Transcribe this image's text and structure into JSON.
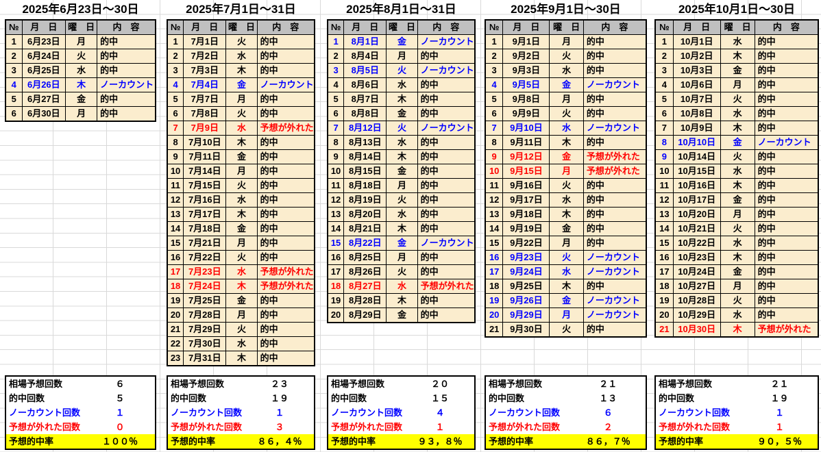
{
  "colors": {
    "hit_text": "#000000",
    "nocount_text": "#0000FF",
    "miss_text": "#FF0000",
    "cell_background": "#FBEDCE",
    "header_background": "#C0C0C0",
    "rate_row_background": "#FFFF00",
    "gridline": "#D9D9D9"
  },
  "column_headers": [
    "№",
    "月　日",
    "曜　日",
    "内　容"
  ],
  "tables": [
    {
      "title": "2025年6月23日～30日",
      "rows": [
        {
          "no": "1",
          "date": "6月23日",
          "day": "月",
          "content": "的中",
          "cls": "hit"
        },
        {
          "no": "2",
          "date": "6月24日",
          "day": "火",
          "content": "的中",
          "cls": "hit"
        },
        {
          "no": "3",
          "date": "6月25日",
          "day": "水",
          "content": "的中",
          "cls": "hit"
        },
        {
          "no": "4",
          "date": "6月26日",
          "day": "木",
          "content": "ノーカウント",
          "cls": "nocount"
        },
        {
          "no": "5",
          "date": "6月27日",
          "day": "金",
          "content": "的中",
          "cls": "hit"
        },
        {
          "no": "6",
          "date": "6月30日",
          "day": "月",
          "content": "的中",
          "cls": "hit"
        }
      ],
      "summary": [
        {
          "label": "相場予想回数",
          "value": "６",
          "cls": "normal"
        },
        {
          "label": "的中回数",
          "value": "５",
          "cls": "normal"
        },
        {
          "label": "ノーカウント回数",
          "value": "１",
          "cls": "nocount"
        },
        {
          "label": "予想が外れた回数",
          "value": "０",
          "cls": "miss"
        },
        {
          "label": "予想的中率",
          "value": "１００％",
          "cls": "rate"
        }
      ]
    },
    {
      "title": "2025年7月1日～31日",
      "rows": [
        {
          "no": "1",
          "date": "7月1日",
          "day": "火",
          "content": "的中",
          "cls": "hit"
        },
        {
          "no": "2",
          "date": "7月2日",
          "day": "水",
          "content": "的中",
          "cls": "hit"
        },
        {
          "no": "3",
          "date": "7月3日",
          "day": "木",
          "content": "的中",
          "cls": "hit"
        },
        {
          "no": "4",
          "date": "7月4日",
          "day": "金",
          "content": "ノーカウント",
          "cls": "nocount"
        },
        {
          "no": "5",
          "date": "7月7日",
          "day": "月",
          "content": "的中",
          "cls": "hit"
        },
        {
          "no": "6",
          "date": "7月8日",
          "day": "火",
          "content": "的中",
          "cls": "hit"
        },
        {
          "no": "7",
          "date": "7月9日",
          "day": "水",
          "content": "予想が外れた",
          "cls": "miss"
        },
        {
          "no": "8",
          "date": "7月10日",
          "day": "木",
          "content": "的中",
          "cls": "hit"
        },
        {
          "no": "9",
          "date": "7月11日",
          "day": "金",
          "content": "的中",
          "cls": "hit"
        },
        {
          "no": "10",
          "date": "7月14日",
          "day": "月",
          "content": "的中",
          "cls": "hit"
        },
        {
          "no": "11",
          "date": "7月15日",
          "day": "火",
          "content": "的中",
          "cls": "hit"
        },
        {
          "no": "12",
          "date": "7月16日",
          "day": "水",
          "content": "的中",
          "cls": "hit"
        },
        {
          "no": "13",
          "date": "7月17日",
          "day": "木",
          "content": "的中",
          "cls": "hit"
        },
        {
          "no": "14",
          "date": "7月18日",
          "day": "金",
          "content": "的中",
          "cls": "hit"
        },
        {
          "no": "15",
          "date": "7月21日",
          "day": "月",
          "content": "的中",
          "cls": "hit"
        },
        {
          "no": "16",
          "date": "7月22日",
          "day": "火",
          "content": "的中",
          "cls": "hit"
        },
        {
          "no": "17",
          "date": "7月23日",
          "day": "水",
          "content": "予想が外れた",
          "cls": "miss"
        },
        {
          "no": "18",
          "date": "7月24日",
          "day": "木",
          "content": "予想が外れた",
          "cls": "miss"
        },
        {
          "no": "19",
          "date": "7月25日",
          "day": "金",
          "content": "的中",
          "cls": "hit"
        },
        {
          "no": "20",
          "date": "7月28日",
          "day": "月",
          "content": "的中",
          "cls": "hit"
        },
        {
          "no": "21",
          "date": "7月29日",
          "day": "火",
          "content": "的中",
          "cls": "hit"
        },
        {
          "no": "22",
          "date": "7月30日",
          "day": "水",
          "content": "的中",
          "cls": "hit"
        },
        {
          "no": "23",
          "date": "7月31日",
          "day": "木",
          "content": "的中",
          "cls": "hit"
        }
      ],
      "summary": [
        {
          "label": "相場予想回数",
          "value": "２３",
          "cls": "normal"
        },
        {
          "label": "的中回数",
          "value": "１９",
          "cls": "normal"
        },
        {
          "label": "ノーカウント回数",
          "value": "１",
          "cls": "nocount"
        },
        {
          "label": "予想が外れた回数",
          "value": "３",
          "cls": "miss"
        },
        {
          "label": "予想的中率",
          "value": "８６，４％",
          "cls": "rate"
        }
      ]
    },
    {
      "title": "2025年8月1日～31日",
      "rows": [
        {
          "no": "1",
          "date": "8月1日",
          "day": "金",
          "content": "ノーカウント",
          "cls": "nocount"
        },
        {
          "no": "2",
          "date": "8月4日",
          "day": "月",
          "content": "的中",
          "cls": "hit"
        },
        {
          "no": "3",
          "date": "8月5日",
          "day": "火",
          "content": "ノーカウント",
          "cls": "nocount"
        },
        {
          "no": "4",
          "date": "8月6日",
          "day": "水",
          "content": "的中",
          "cls": "hit"
        },
        {
          "no": "5",
          "date": "8月7日",
          "day": "木",
          "content": "的中",
          "cls": "hit"
        },
        {
          "no": "6",
          "date": "8月8日",
          "day": "金",
          "content": "的中",
          "cls": "hit"
        },
        {
          "no": "7",
          "date": "8月12日",
          "day": "火",
          "content": "ノーカウント",
          "cls": "nocount"
        },
        {
          "no": "8",
          "date": "8月13日",
          "day": "水",
          "content": "的中",
          "cls": "hit"
        },
        {
          "no": "9",
          "date": "8月14日",
          "day": "木",
          "content": "的中",
          "cls": "hit"
        },
        {
          "no": "10",
          "date": "8月15日",
          "day": "金",
          "content": "的中",
          "cls": "hit"
        },
        {
          "no": "11",
          "date": "8月18日",
          "day": "月",
          "content": "的中",
          "cls": "hit"
        },
        {
          "no": "12",
          "date": "8月19日",
          "day": "火",
          "content": "的中",
          "cls": "hit"
        },
        {
          "no": "13",
          "date": "8月20日",
          "day": "水",
          "content": "的中",
          "cls": "hit"
        },
        {
          "no": "14",
          "date": "8月21日",
          "day": "木",
          "content": "的中",
          "cls": "hit"
        },
        {
          "no": "15",
          "date": "8月22日",
          "day": "金",
          "content": "ノーカウント",
          "cls": "nocount"
        },
        {
          "no": "16",
          "date": "8月25日",
          "day": "月",
          "content": "的中",
          "cls": "hit"
        },
        {
          "no": "17",
          "date": "8月26日",
          "day": "火",
          "content": "的中",
          "cls": "hit"
        },
        {
          "no": "18",
          "date": "8月27日",
          "day": "水",
          "content": "予想が外れた",
          "cls": "miss"
        },
        {
          "no": "19",
          "date": "8月28日",
          "day": "木",
          "content": "的中",
          "cls": "hit"
        },
        {
          "no": "20",
          "date": "8月29日",
          "day": "金",
          "content": "的中",
          "cls": "hit"
        }
      ],
      "summary": [
        {
          "label": "相場予想回数",
          "value": "２０",
          "cls": "normal"
        },
        {
          "label": "的中回数",
          "value": "１５",
          "cls": "normal"
        },
        {
          "label": "ノーカウント回数",
          "value": "４",
          "cls": "nocount"
        },
        {
          "label": "予想が外れた回数",
          "value": "１",
          "cls": "miss"
        },
        {
          "label": "予想的中率",
          "value": "９３，８％",
          "cls": "rate"
        }
      ]
    },
    {
      "title": "2025年9月1日～30日",
      "rows": [
        {
          "no": "1",
          "date": "9月1日",
          "day": "月",
          "content": "的中",
          "cls": "hit"
        },
        {
          "no": "2",
          "date": "9月2日",
          "day": "火",
          "content": "的中",
          "cls": "hit"
        },
        {
          "no": "3",
          "date": "9月3日",
          "day": "水",
          "content": "的中",
          "cls": "hit"
        },
        {
          "no": "4",
          "date": "9月5日",
          "day": "金",
          "content": "ノーカウント",
          "cls": "nocount"
        },
        {
          "no": "5",
          "date": "9月8日",
          "day": "月",
          "content": "的中",
          "cls": "hit"
        },
        {
          "no": "6",
          "date": "9月9日",
          "day": "火",
          "content": "的中",
          "cls": "hit"
        },
        {
          "no": "7",
          "date": "9月10日",
          "day": "水",
          "content": "ノーカウント",
          "cls": "nocount"
        },
        {
          "no": "8",
          "date": "9月11日",
          "day": "木",
          "content": "的中",
          "cls": "hit"
        },
        {
          "no": "9",
          "date": "9月12日",
          "day": "金",
          "content": "予想が外れた",
          "cls": "miss"
        },
        {
          "no": "10",
          "date": "9月15日",
          "day": "月",
          "content": "予想が外れた",
          "cls": "miss"
        },
        {
          "no": "11",
          "date": "9月16日",
          "day": "火",
          "content": "的中",
          "cls": "hit"
        },
        {
          "no": "12",
          "date": "9月17日",
          "day": "水",
          "content": "的中",
          "cls": "hit"
        },
        {
          "no": "13",
          "date": "9月18日",
          "day": "木",
          "content": "的中",
          "cls": "hit"
        },
        {
          "no": "14",
          "date": "9月19日",
          "day": "金",
          "content": "的中",
          "cls": "hit"
        },
        {
          "no": "15",
          "date": "9月22日",
          "day": "月",
          "content": "的中",
          "cls": "hit"
        },
        {
          "no": "16",
          "date": "9月23日",
          "day": "火",
          "content": "ノーカウント",
          "cls": "nocount"
        },
        {
          "no": "17",
          "date": "9月24日",
          "day": "水",
          "content": "ノーカウント",
          "cls": "nocount"
        },
        {
          "no": "18",
          "date": "9月25日",
          "day": "木",
          "content": "的中",
          "cls": "hit"
        },
        {
          "no": "19",
          "date": "9月26日",
          "day": "金",
          "content": "ノーカウント",
          "cls": "nocount"
        },
        {
          "no": "20",
          "date": "9月29日",
          "day": "月",
          "content": "ノーカウント",
          "cls": "nocount"
        },
        {
          "no": "21",
          "date": "9月30日",
          "day": "火",
          "content": "的中",
          "cls": "hit"
        }
      ],
      "summary": [
        {
          "label": "相場予想回数",
          "value": "２１",
          "cls": "normal"
        },
        {
          "label": "的中回数",
          "value": "１３",
          "cls": "normal"
        },
        {
          "label": "ノーカウント回数",
          "value": "６",
          "cls": "nocount"
        },
        {
          "label": "予想が外れた回数",
          "value": "２",
          "cls": "miss"
        },
        {
          "label": "予想的中率",
          "value": "８６，７％",
          "cls": "rate"
        }
      ]
    },
    {
      "title": "2025年10月1日～30日",
      "rows": [
        {
          "no": "1",
          "date": "10月1日",
          "day": "水",
          "content": "的中",
          "cls": "hit"
        },
        {
          "no": "2",
          "date": "10月2日",
          "day": "木",
          "content": "的中",
          "cls": "hit"
        },
        {
          "no": "3",
          "date": "10月3日",
          "day": "金",
          "content": "的中",
          "cls": "hit"
        },
        {
          "no": "4",
          "date": "10月6日",
          "day": "月",
          "content": "的中",
          "cls": "hit"
        },
        {
          "no": "5",
          "date": "10月7日",
          "day": "火",
          "content": "的中",
          "cls": "hit"
        },
        {
          "no": "6",
          "date": "10月8日",
          "day": "水",
          "content": "的中",
          "cls": "hit"
        },
        {
          "no": "7",
          "date": "10月9日",
          "day": "木",
          "content": "的中",
          "cls": "hit"
        },
        {
          "no": "8",
          "date": "10月10日",
          "day": "金",
          "content": "ノーカウント",
          "cls": "nocount"
        },
        {
          "no": "9",
          "date": "10月14日",
          "day": "火",
          "content": "的中",
          "cls": "hit",
          "no_cls": "nocount"
        },
        {
          "no": "10",
          "date": "10月15日",
          "day": "水",
          "content": "的中",
          "cls": "hit"
        },
        {
          "no": "11",
          "date": "10月16日",
          "day": "木",
          "content": "的中",
          "cls": "hit"
        },
        {
          "no": "12",
          "date": "10月17日",
          "day": "金",
          "content": "的中",
          "cls": "hit"
        },
        {
          "no": "13",
          "date": "10月20日",
          "day": "月",
          "content": "的中",
          "cls": "hit"
        },
        {
          "no": "14",
          "date": "10月21日",
          "day": "火",
          "content": "的中",
          "cls": "hit"
        },
        {
          "no": "15",
          "date": "10月22日",
          "day": "水",
          "content": "的中",
          "cls": "hit"
        },
        {
          "no": "16",
          "date": "10月23日",
          "day": "木",
          "content": "的中",
          "cls": "hit"
        },
        {
          "no": "17",
          "date": "10月24日",
          "day": "金",
          "content": "的中",
          "cls": "hit"
        },
        {
          "no": "18",
          "date": "10月27日",
          "day": "月",
          "content": "的中",
          "cls": "hit"
        },
        {
          "no": "19",
          "date": "10月28日",
          "day": "火",
          "content": "的中",
          "cls": "hit"
        },
        {
          "no": "20",
          "date": "10月29日",
          "day": "水",
          "content": "的中",
          "cls": "hit"
        },
        {
          "no": "21",
          "date": "10月30日",
          "day": "木",
          "content": "予想が外れた",
          "cls": "miss"
        }
      ],
      "summary": [
        {
          "label": "相場予想回数",
          "value": "２１",
          "cls": "normal"
        },
        {
          "label": "的中回数",
          "value": "１９",
          "cls": "normal"
        },
        {
          "label": "ノーカウント回数",
          "value": "１",
          "cls": "nocount"
        },
        {
          "label": "予想が外れた回数",
          "value": "１",
          "cls": "miss"
        },
        {
          "label": "予想的中率",
          "value": "９０，５％",
          "cls": "rate"
        }
      ]
    }
  ]
}
